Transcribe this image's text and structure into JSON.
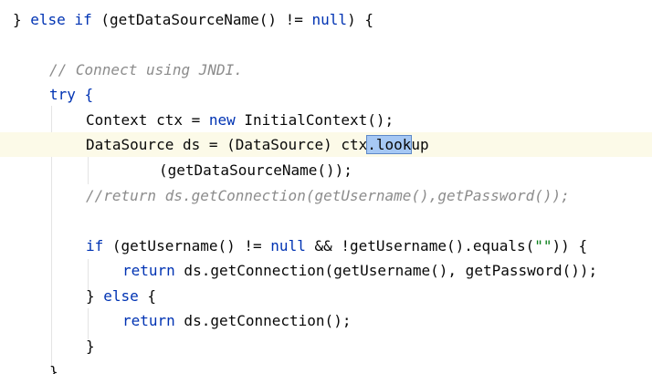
{
  "code": {
    "line_else_if": "} else if (getDataSourceName() != null) {",
    "line_comment_jndi": "// Connect using JNDI.",
    "line_try": "try {",
    "line_context": "Context ctx = new InitialContext();",
    "line_datasource_a": "DataSource ds = (DataSource) ctx",
    "line_datasource_sel": ".look",
    "line_datasource_b": "up",
    "line_datasource_cont": "(getDataSourceName());",
    "line_comment_return": "//return ds.getConnection(getUsername(),getPassword());",
    "line_if_username": "if (getUsername() != null && !getUsername().equals(\"\")) {",
    "line_return_creds": "return ds.getConnection(getUsername(), getPassword());",
    "line_else": "} else {",
    "line_return_plain": "return ds.getConnection();",
    "line_close_inner": "}",
    "line_close_outer": "}"
  },
  "colors": {
    "keyword": "#0033b3",
    "comment": "#8c8c8c",
    "string": "#067d17",
    "text": "#080808",
    "current_line": "#fcfae8",
    "selection": "#a6c8f4"
  }
}
